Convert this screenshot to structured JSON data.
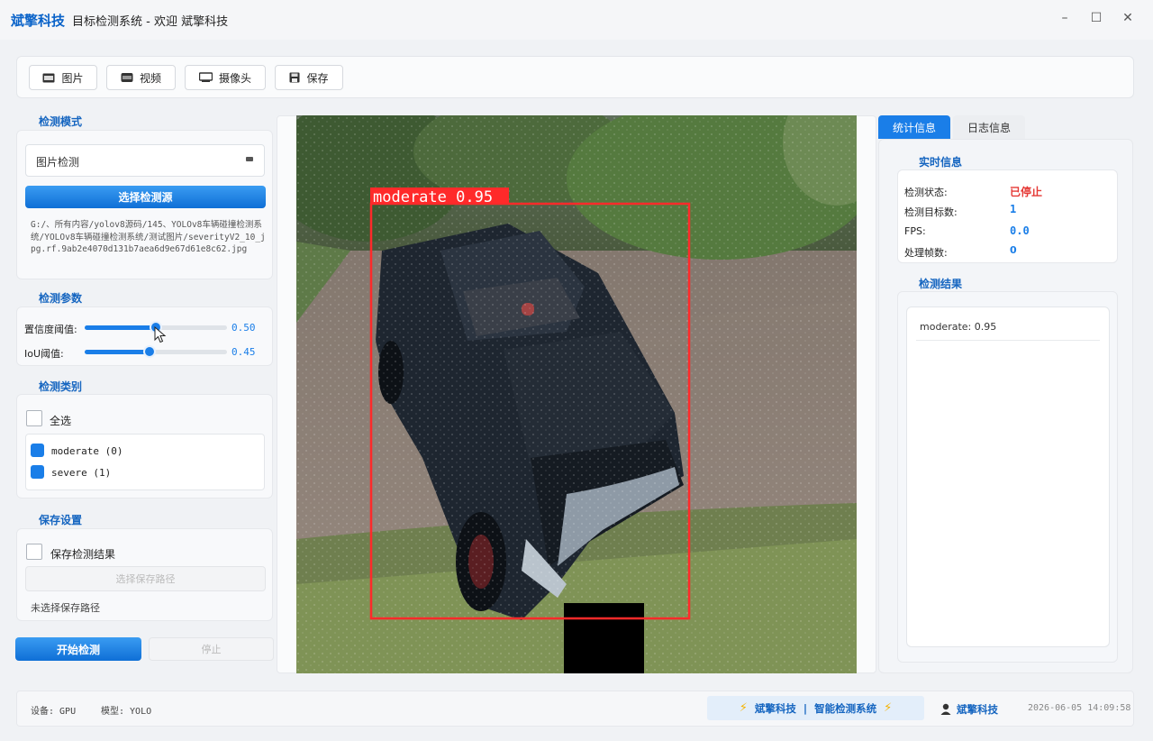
{
  "titlebar": {
    "brand": "斌擎科技",
    "title": "目标检测系统 - 欢迎 斌擎科技",
    "minimize": "–",
    "maximize": "☐",
    "close": "✕"
  },
  "toolbar": {
    "image_label": "图片",
    "video_label": "视频",
    "camera_label": "摄像头",
    "save_label": "保存"
  },
  "left": {
    "mode_title": "检测模式",
    "mode_value": "图片检测",
    "select_source_label": "选择检测源",
    "source_path": "G:/、所有内容/yolov8源码/145、YOLOv8车辆碰撞检测系统/YOLOv8车辆碰撞检测系统/测试图片/severityV2_10_jpg.rf.9ab2e4070d131b7aea6d9e67d61e8c62.jpg",
    "params_title": "检测参数",
    "conf_label": "置信度阈值:",
    "conf_value": "0.50",
    "conf_level": 0.5,
    "iou_label": "IoU阈值:",
    "iou_value": "0.45",
    "iou_level": 0.45,
    "classes_title": "检测类别",
    "select_all": "全选",
    "classes": [
      {
        "label": "moderate (0)",
        "checked": true
      },
      {
        "label": "severe (1)",
        "checked": true
      }
    ],
    "save_title": "保存设置",
    "save_results": "保存检测结果",
    "choose_path": "选择保存路径",
    "no_path": "未选择保存路径",
    "start": "开始检测",
    "stop": "停止"
  },
  "detection": {
    "box_label": "moderate 0.95",
    "box_color": "#ff2a2a"
  },
  "right": {
    "tab_stats": "统计信息",
    "tab_log": "日志信息",
    "realtime_title": "实时信息",
    "status_label": "检测状态:",
    "status_value": "已停止",
    "count_label": "检测目标数:",
    "count_value": "1",
    "fps_label": "FPS:",
    "fps_value": "0.0",
    "frames_label": "处理帧数:",
    "frames_value": "0",
    "results_title": "检测结果",
    "results": [
      "moderate: 0.95"
    ]
  },
  "statusbar": {
    "device": "设备: GPU",
    "model": "模型: YOLO",
    "center": "斌擎科技  |  智能检测系统",
    "user": "斌擎科技",
    "datetime": "2026-06-05 14:09:58"
  },
  "colors": {
    "accent": "#1a7ee8",
    "title_blue": "#1565c0",
    "stopped_red": "#e53935"
  }
}
